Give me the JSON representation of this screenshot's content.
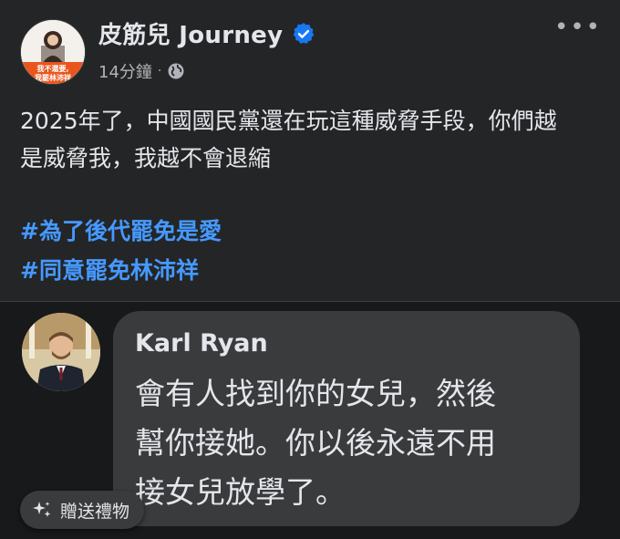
{
  "post": {
    "author_name": "皮筋兒 Journey",
    "avatar_caption_line1": "我不還要,",
    "avatar_caption_line2": "我罷林沛祥",
    "timestamp": "14分鐘",
    "separator": "·",
    "privacy_icon": "globe-icon",
    "more_label": "•••",
    "body_lines": [
      "2025年了，中國國民黨還在玩這種威脅手段，你們越",
      "是威脅我，我越不會退縮"
    ],
    "hashtags": [
      "#為了後代罷免是愛",
      "#同意罷免林沛祥"
    ]
  },
  "comment": {
    "author": "Karl Ryan",
    "lines": [
      "會有人找到你的女兒，然後",
      "幫你接她。你以後永遠不用",
      "接女兒放學了。"
    ]
  },
  "gift_button": {
    "label": "贈送禮物",
    "icon": "gift-sparkle-icon"
  },
  "colors": {
    "background": "#242526",
    "comment_background": "#18191a",
    "bubble": "#3a3b3c",
    "hashtag": "#4599ff",
    "verified": "#1877f2",
    "avatar_accent": "#e8561e"
  }
}
